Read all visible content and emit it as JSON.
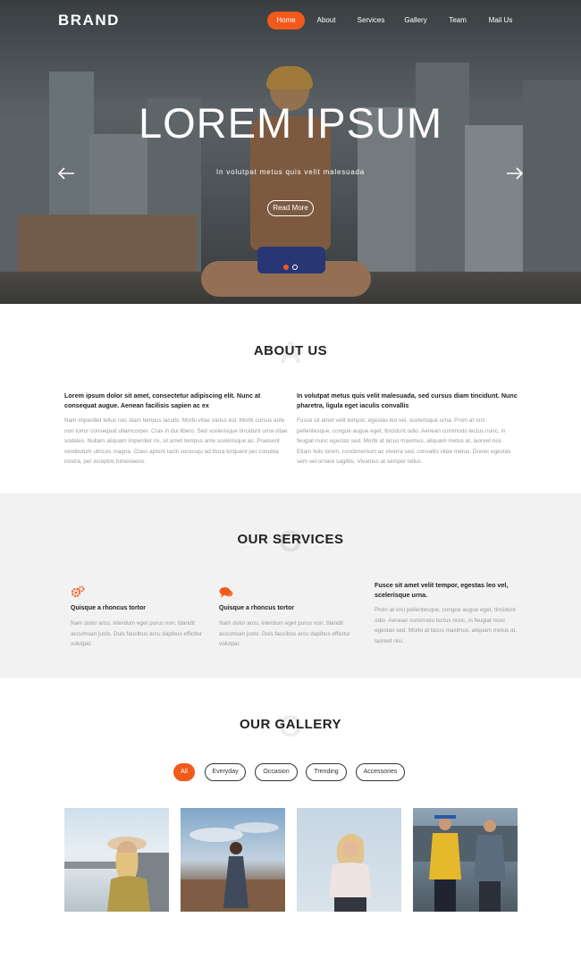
{
  "brand": "BRAND",
  "nav": {
    "items": [
      "Home",
      "About",
      "Services",
      "Gallery",
      "Team",
      "Mail Us"
    ],
    "active": "Home"
  },
  "hero": {
    "title": "LOREM IPSUM",
    "subtitle": "In volutpat metus quis velit malesuada",
    "button": "Read More",
    "prev_icon": "arrow-left-icon",
    "next_icon": "arrow-right-icon",
    "slides": 2,
    "active_slide": 1
  },
  "about": {
    "title": "ABOUT US",
    "ghost_letter": "A",
    "left": {
      "heading": "Lorem ipsum dolor sit amet, consectetur adipiscing elit. Nunc at consequat augue. Aenean facilisis sapien ac ex",
      "body": "Nam imperdiet tellus nec diam tempus iaculis. Morbi vitae varius est. Morbi cursus ante non tortor consequat ullamcorper. Cras in dui libero. Sed scelerisque tincidunt urna vitae sodales. Nullam aliquam imperdiet mi, sit amet tempus ante scelerisque ac. Praesent vestibulum ultrices magna. Class aptent taciti sociosqu ad litora torquent per conubia nostra, per inceptos himenaeos."
    },
    "right": {
      "heading": "In volutpat metus quis velit malesuada, sed cursus diam tincidunt. Nunc pharetra, ligula eget iaculis convallis",
      "body": "Fusce sit amet velit tempor, egestas leo vel, scelerisque urna. Proin at orci pellentesque, congue augue eget, tincidunt odio. Aenean commodo lectus nunc, in feugiat nunc egestas sed. Morbi at lacus maximus, aliquam metus at, laoreet nisi. Etiam felis lorem, condimentum ac viverra sed, convallis vitae metus. Donec egestas sem vel ornare sagittis. Vivamus at semper tellus."
    }
  },
  "services": {
    "title": "OUR SERVICES",
    "ghost_letter": "O",
    "items": [
      {
        "icon": "gears-icon",
        "title": "Quisque a rhoncus tortor",
        "body": "Nam dolor arcu, interdum eget purus non, blandit accumsan justo. Duis faucibus arcu dapibus efficitur volutpat."
      },
      {
        "icon": "chat-bubbles-icon",
        "title": "Quisque a rhoncus tortor",
        "body": "Nam dolor arcu, interdum eget purus non, blandit accumsan justo. Duis faucibus arcu dapibus efficitur volutpat."
      }
    ],
    "feature": {
      "heading": "Fusce sit amet velit tempor, egestas leo vel, scelerisque urna.",
      "body": "Proin at orci pellentesque, congue augue eget, tincidunt odio. Aenean commodo lectus nunc, in feugiat nunc egestas sed. Morbi at lacus maximus, aliquam metus at, laoreet nisi."
    }
  },
  "gallery": {
    "title": "OUR GALLERY",
    "ghost_letter": "O",
    "filters": [
      "All",
      "Everyday",
      "Occasion",
      "Trending",
      "Accessories"
    ],
    "active_filter": "All"
  },
  "colors": {
    "accent": "#f15a1b",
    "dark": "#222222",
    "muted": "#9a9a9a",
    "section_bg": "#f2f2f2"
  }
}
